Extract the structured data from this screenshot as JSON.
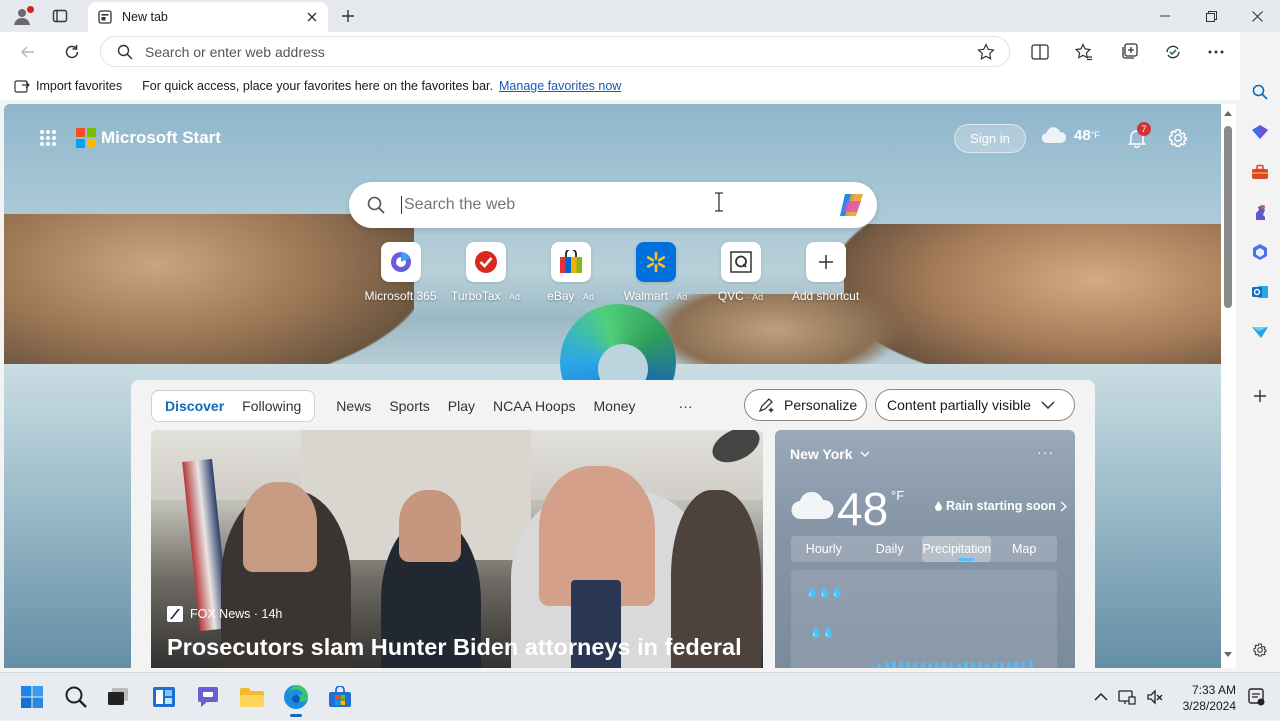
{
  "tab": {
    "title": "New tab"
  },
  "address_bar": {
    "placeholder": "Search or enter web address"
  },
  "favorites_bar": {
    "import_label": "Import favorites",
    "message": "For quick access, place your favorites here on the favorites bar.",
    "link": "Manage favorites now"
  },
  "header": {
    "brand": "Microsoft Start",
    "sign_in": "Sign in",
    "weather_temp": "48",
    "weather_unit": "°F",
    "notification_count": "7"
  },
  "search": {
    "placeholder": "Search the web"
  },
  "shortcuts": [
    {
      "label": "Microsoft 365",
      "ad": "",
      "icon": "microsoft-365-icon"
    },
    {
      "label": "TurboTax",
      "ad": "· Ad",
      "icon": "turbotax-icon"
    },
    {
      "label": "eBay",
      "ad": "· Ad",
      "icon": "ebay-icon"
    },
    {
      "label": "Walmart",
      "ad": "· Ad",
      "icon": "walmart-icon"
    },
    {
      "label": "QVC",
      "ad": "· Ad",
      "icon": "qvc-icon"
    },
    {
      "label": "Add shortcut",
      "ad": "",
      "icon": "plus-icon"
    }
  ],
  "feed": {
    "pivots": [
      "Discover",
      "Following",
      "News",
      "Sports",
      "Play",
      "NCAA Hoops",
      "Money"
    ],
    "selected_pivot": "Discover",
    "more": "···",
    "personalize": "Personalize",
    "content_visibility": "Content partially visible"
  },
  "hero": {
    "source": "FOX News · 14h",
    "title": "Prosecutors slam Hunter Biden attorneys in federal"
  },
  "weather_card": {
    "location": "New York",
    "more": "···",
    "temp": "48",
    "unit": "°F",
    "alert": "Rain starting soon",
    "tabs": [
      "Hourly",
      "Daily",
      "Precipitation",
      "Map"
    ],
    "selected_tab": "Precipitation",
    "drops_high": "💧💧💧",
    "drops_low": "💧💧"
  },
  "taskbar": {
    "time": "7:33 AM",
    "date": "3/28/2024"
  },
  "colors": {
    "accent": "#0f6cbd",
    "link": "#1759b6",
    "badge": "#d13438",
    "precip_bar": "#5ab8ee"
  }
}
